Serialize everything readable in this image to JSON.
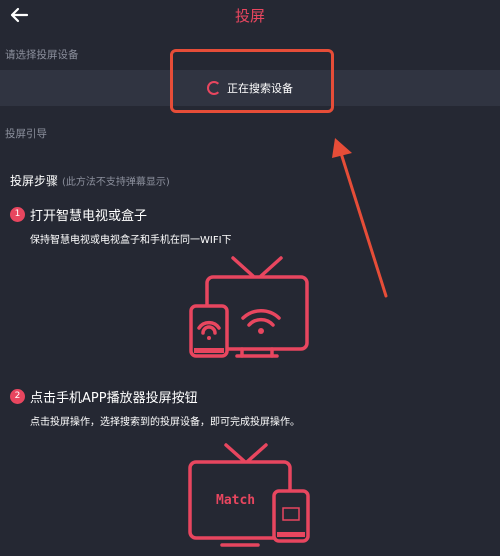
{
  "header": {
    "title": "投屏",
    "back_icon": "arrow-left-icon"
  },
  "device_select": {
    "label": "请选择投屏设备",
    "status": "正在搜索设备"
  },
  "guide": {
    "label": "投屏引导",
    "steps_title": "投屏步骤",
    "steps_note": "(此方法不支持弹幕显示)",
    "steps": [
      {
        "num": "1",
        "title": "打开智慧电视或盒子",
        "desc": "保持智慧电视或电视盒子和手机在同一WIFI下"
      },
      {
        "num": "2",
        "title": "点击手机APP播放器投屏按钮",
        "desc": "点击投屏操作，选择搜索到的投屏设备，即可完成投屏操作。"
      }
    ],
    "tv_screen_text": "Match"
  },
  "colors": {
    "accent": "#e8465f",
    "annotation": "#e64d38",
    "background": "#252833",
    "bar": "#303441"
  }
}
